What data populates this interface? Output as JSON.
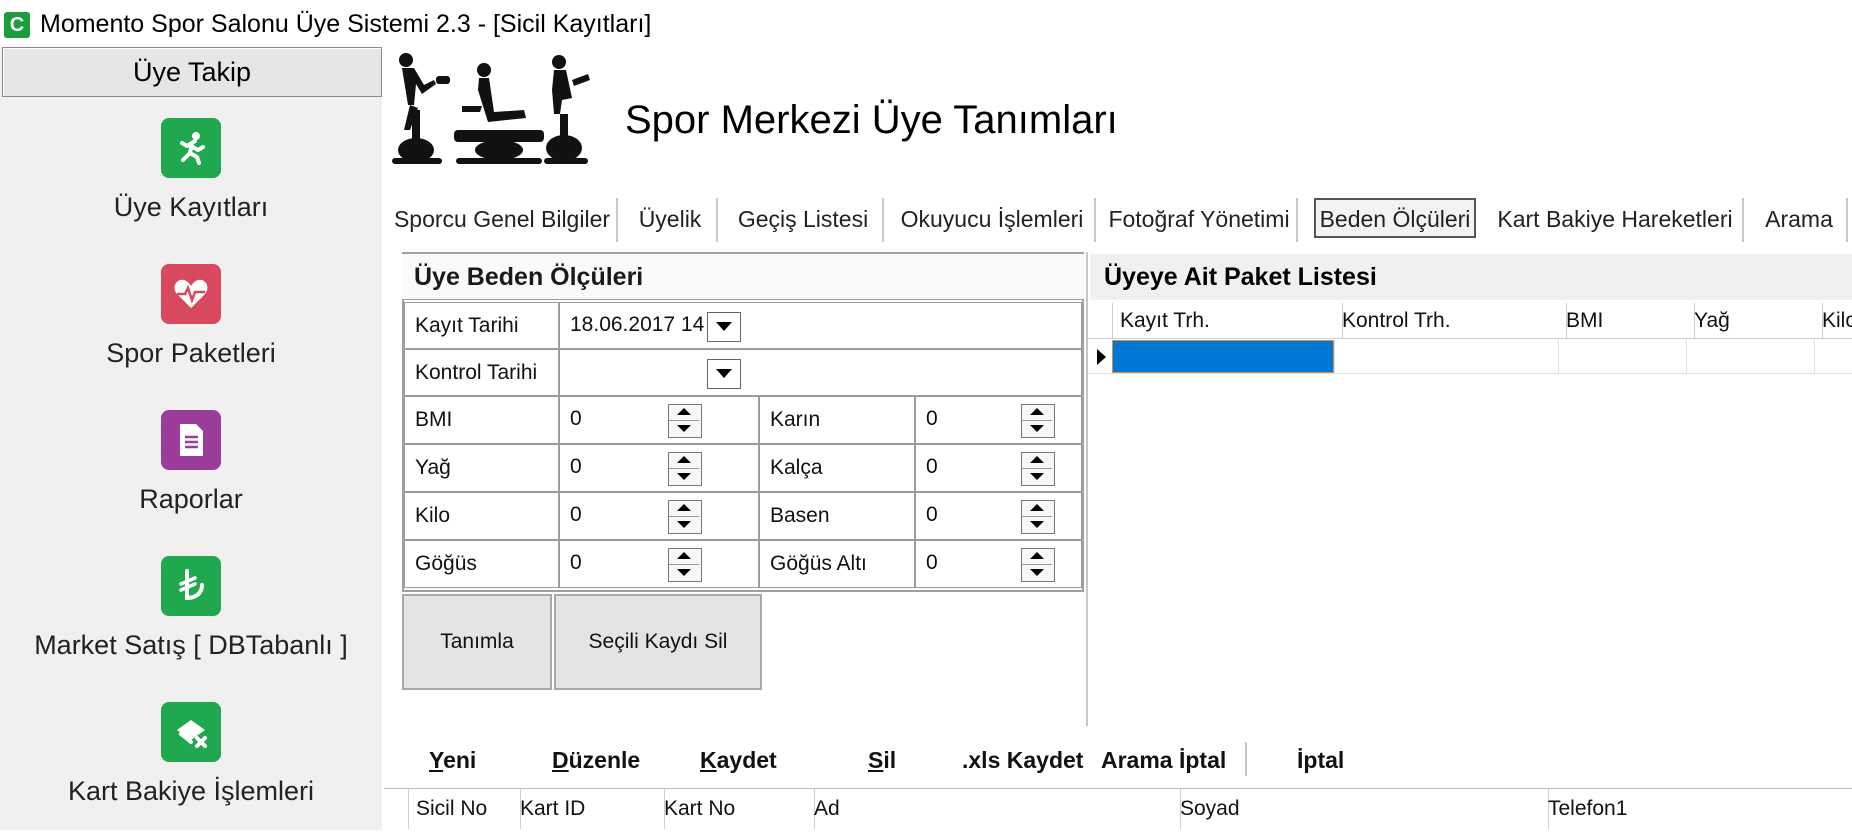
{
  "window": {
    "title": "Momento Spor Salonu Üye Sistemi  2.3 - [Sicil Kayıtları]",
    "icon_letter": "C"
  },
  "sidebar": {
    "header": "Üye Takip",
    "items": [
      {
        "label": "Üye Kayıtları",
        "icon": "runner-icon",
        "color": "#1fa84e"
      },
      {
        "label": "Spor Paketleri",
        "icon": "heart-pulse-icon",
        "color": "#d8485f"
      },
      {
        "label": "Raporlar",
        "icon": "document-icon",
        "color": "#9b3c9b"
      },
      {
        "label": "Market Satış [ DBTabanlı ]",
        "icon": "lira-icon",
        "color": "#1fa84e"
      },
      {
        "label": "Kart Bakiye İşlemleri",
        "icon": "card-remove-icon",
        "color": "#1fa84e"
      }
    ]
  },
  "header": {
    "title": "Spor Merkezi Üye Tanımları"
  },
  "tabs": [
    {
      "label": "Sporcu Genel Bilgiler"
    },
    {
      "label": "Üyelik"
    },
    {
      "label": "Geçiş Listesi"
    },
    {
      "label": "Okuyucu İşlemleri"
    },
    {
      "label": "Fotoğraf Yönetimi"
    },
    {
      "label": "Beden Ölçüleri",
      "active": true
    },
    {
      "label": "Kart Bakiye Hareketleri"
    },
    {
      "label": "Arama"
    }
  ],
  "measurements": {
    "title": "Üye Beden Ölçüleri",
    "kayit_tarihi_label": "Kayıt Tarihi",
    "kayit_tarihi_value": "18.06.2017 14",
    "kontrol_tarihi_label": "Kontrol Tarihi",
    "kontrol_tarihi_value": "",
    "fields_left": [
      {
        "label": "BMI",
        "value": "0"
      },
      {
        "label": "Yağ",
        "value": "0"
      },
      {
        "label": "Kilo",
        "value": "0"
      },
      {
        "label": "Göğüs",
        "value": "0"
      }
    ],
    "fields_right": [
      {
        "label": "Karın",
        "value": "0"
      },
      {
        "label": "Kalça",
        "value": "0"
      },
      {
        "label": "Basen",
        "value": "0"
      },
      {
        "label": "Göğüs Altı",
        "value": "0"
      }
    ],
    "define_button": "Tanımla",
    "delete_button": "Seçili Kaydı Sil"
  },
  "packages": {
    "title": "Üyeye Ait Paket Listesi",
    "columns": [
      "Kayıt Trh.",
      "Kontrol Trh.",
      "BMI",
      "Yağ",
      "Kilo"
    ],
    "selection_color": "#0078d7"
  },
  "toolbar": {
    "yeni": {
      "u": "Y",
      "rest": "eni"
    },
    "duzenle": {
      "u": "D",
      "rest": "üzenle"
    },
    "kaydet": {
      "u": "K",
      "rest": "aydet"
    },
    "sil": {
      "u": "S",
      "rest": "il"
    },
    "xls": ".xls Kaydet",
    "arama_iptal": "Arama İptal",
    "iptal": "İptal"
  },
  "members_grid": {
    "columns": [
      "Sicil No",
      "Kart ID",
      "Kart No",
      "Ad",
      "Soyad",
      "Telefon1"
    ]
  }
}
